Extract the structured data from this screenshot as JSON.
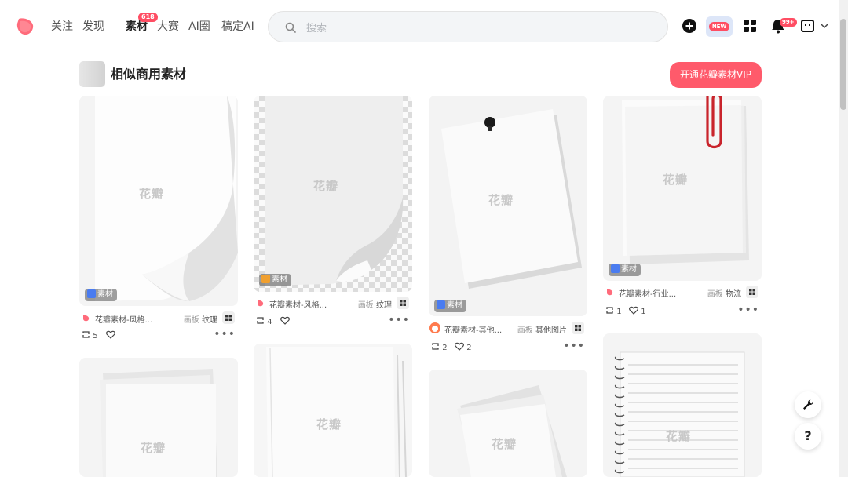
{
  "nav": {
    "follow": "关注",
    "discover": "发现",
    "material": "素材",
    "material_badge": "618",
    "contest": "大赛",
    "ai_circle": "AI圈",
    "gaoding_ai": "稿定AI"
  },
  "search": {
    "placeholder": "搜索"
  },
  "header_icons": {
    "new_badge": "NEW",
    "notif_badge": "99+"
  },
  "section": {
    "title": "相似商用素材",
    "vip_button": "开通花瓣素材VIP"
  },
  "watermark": "花瓣",
  "cards": [
    {
      "tag": "素材",
      "source": "花瓣素材-风格...",
      "board_label": "画板",
      "board": "纹理",
      "repins": "5",
      "likes": ""
    },
    {
      "tag": "素材",
      "source": "花瓣素材-风格...",
      "board_label": "画板",
      "board": "纹理",
      "repins": "4",
      "likes": ""
    },
    {
      "tag": "素材",
      "source": "花瓣素材-其他...",
      "board_label": "画板",
      "board": "其他图片",
      "repins": "2",
      "likes": "2"
    },
    {
      "tag": "素材",
      "source": "花瓣素材-行业...",
      "board_label": "画板",
      "board": "物流",
      "repins": "1",
      "likes": "1"
    }
  ],
  "float": {
    "help": "?"
  },
  "colors": {
    "accent": "#ff5a6b",
    "badge": "#ff4d63",
    "tag_blue": "#4a7cf0",
    "tag_ai": "#f0a030"
  },
  "icons": [
    "search-icon",
    "add-icon",
    "grid-icon",
    "bell-icon",
    "user-menu-icon",
    "chevron-down-icon",
    "wrench-icon",
    "help-icon",
    "repin-icon",
    "heart-icon",
    "more-icon",
    "board-grid-icon"
  ]
}
